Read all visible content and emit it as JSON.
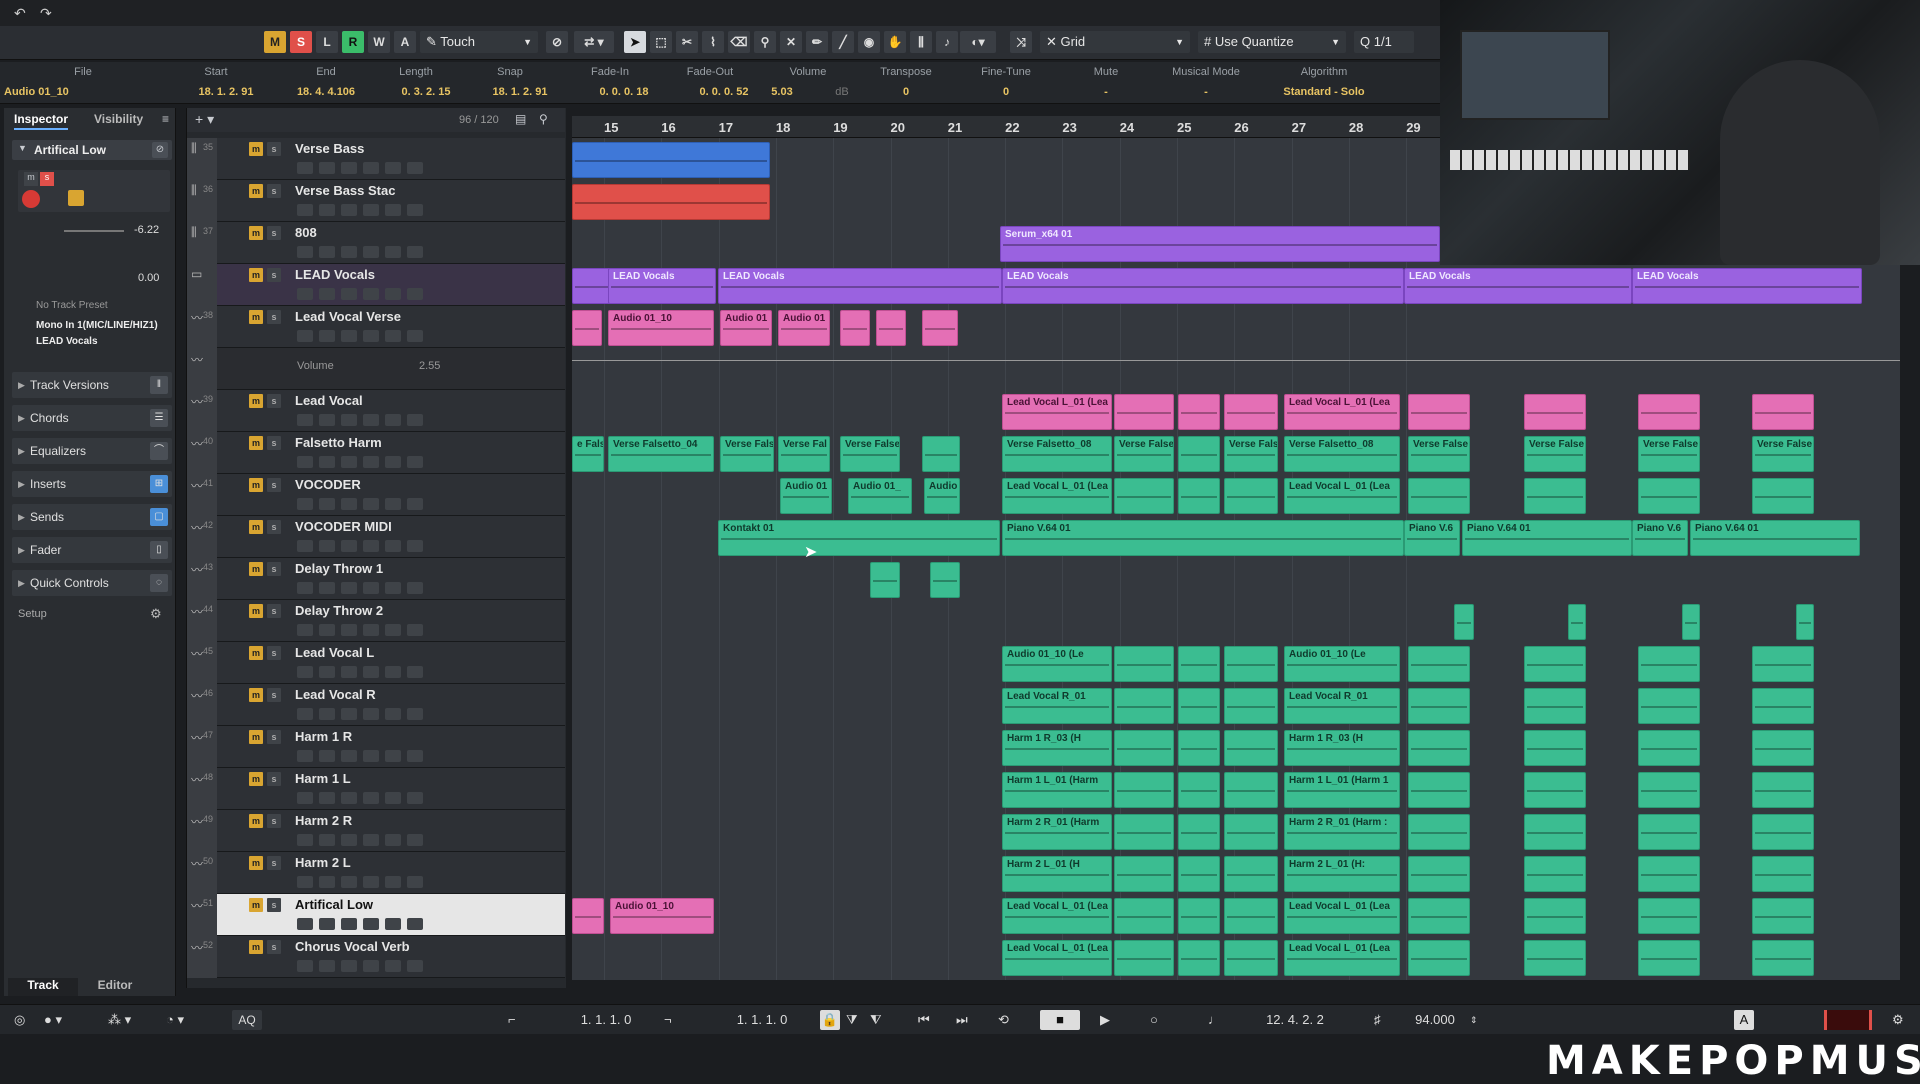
{
  "toolbar": {
    "m": "M",
    "s": "S",
    "l": "L",
    "r": "R",
    "w": "W",
    "a": "A",
    "automation_mode": "Touch",
    "snap_type": "Grid",
    "quantize": "Use Quantize",
    "quantize_value": "1/1"
  },
  "infoline": {
    "headers": [
      "File",
      "Start",
      "End",
      "Length",
      "Snap",
      "Fade-In",
      "Fade-Out",
      "Volume",
      "Transpose",
      "Fine-Tune",
      "Mute",
      "Musical Mode",
      "Algorithm"
    ],
    "values": [
      "Audio 01_10",
      "18. 1. 2. 91",
      "18. 4. 4.106",
      "0. 3. 2. 15",
      "18. 1. 2. 91",
      "0. 0. 0. 18",
      "0. 0. 0. 52",
      "5.03",
      "0",
      "0",
      "-",
      "-",
      "Standard - Solo"
    ],
    "volume_unit": "dB"
  },
  "inspector": {
    "tab_inspector": "Inspector",
    "tab_visibility": "Visibility",
    "track_name": "Artifical Low",
    "volume_value": "-6.22",
    "pan_value": "0.00",
    "preset": "No Track Preset",
    "input": "Mono In 1(MIC/LINE/HIZ1)",
    "output": "LEAD Vocals",
    "sections": [
      "Track Versions",
      "Chords",
      "Equalizers",
      "Inserts",
      "Sends",
      "Fader",
      "Quick Controls"
    ],
    "setup": "Setup",
    "bottom_tab_track": "Track",
    "bottom_tab_editor": "Editor"
  },
  "tracklist": {
    "count": "96 / 120",
    "tracks": [
      {
        "num": "35",
        "name": "Verse Bass"
      },
      {
        "num": "36",
        "name": "Verse Bass Stac"
      },
      {
        "num": "37",
        "name": "808"
      },
      {
        "num": "",
        "name": "LEAD Vocals"
      },
      {
        "num": "38",
        "name": "Lead Vocal Verse"
      },
      {
        "num": "",
        "name": "Volume"
      },
      {
        "num": "39",
        "name": "Lead Vocal"
      },
      {
        "num": "40",
        "name": "Falsetto Harm"
      },
      {
        "num": "41",
        "name": "VOCODER"
      },
      {
        "num": "42",
        "name": "VOCODER MIDI"
      },
      {
        "num": "43",
        "name": "Delay Throw 1"
      },
      {
        "num": "44",
        "name": "Delay Throw 2"
      },
      {
        "num": "45",
        "name": "Lead Vocal L"
      },
      {
        "num": "46",
        "name": "Lead Vocal R"
      },
      {
        "num": "47",
        "name": "Harm 1 R"
      },
      {
        "num": "48",
        "name": "Harm 1 L"
      },
      {
        "num": "49",
        "name": "Harm 2 R"
      },
      {
        "num": "50",
        "name": "Harm 2 L"
      },
      {
        "num": "51",
        "name": "Artifical Low"
      },
      {
        "num": "52",
        "name": "Chorus Vocal Verb"
      }
    ],
    "automation_value": "2.55"
  },
  "ruler": {
    "bars": [
      "15",
      "16",
      "17",
      "18",
      "19",
      "20",
      "21",
      "22",
      "23",
      "24",
      "25",
      "26",
      "27",
      "28",
      "29"
    ]
  },
  "events": {
    "serum": "Serum_x64 01",
    "lead_vocals": "LEAD Vocals",
    "audio_01_10": "Audio 01_10",
    "audio_01": "Audio 01",
    "audio_01_": "Audio 01_",
    "audio": "Audio",
    "lead_vocal_l01": "Lead Vocal L_01 (Lea",
    "verse_falsetto_04": "Verse Falsetto_04",
    "verse_fals": "Verse Fals",
    "verse_fal": "Verse Fal",
    "verse_false": "Verse False",
    "verse_falsetto_08": "Verse Falsetto_08",
    "e_fals": "e Fals",
    "kontakt": "Kontakt 01",
    "piano": "Piano V.64 01",
    "piano_short": "Piano V.6",
    "audio_01_10_le": "Audio 01_10 (Le",
    "lead_vocal_r01": "Lead Vocal R_01",
    "harm1r": "Harm 1 R_03 (H",
    "harm1l": "Harm 1 L_01 (Harm",
    "harm1l_b": "Harm 1 L_01 (Harm 1",
    "harm2r": "Harm 2 R_01 (Harm",
    "harm2r_b": "Harm 2 R_01 (Harm :",
    "harm2l": "Harm 2 L_01 (H",
    "harm2l_b": "Harm 2 L_01 (H:"
  },
  "transport": {
    "left_locator": "1. 1. 1.   0",
    "right_locator": "1. 1. 1.   0",
    "position": "12. 4. 2.   2",
    "tempo": "94.000",
    "aq": "AQ"
  },
  "brand": "MAKEPOPMUSIC",
  "colors": {
    "teal": "#3bbd91",
    "pink": "#e46fb5",
    "purple": "#9a62e0",
    "blue": "#3f78d8",
    "red": "#e0504a",
    "mute_yellow": "#d9a531"
  }
}
